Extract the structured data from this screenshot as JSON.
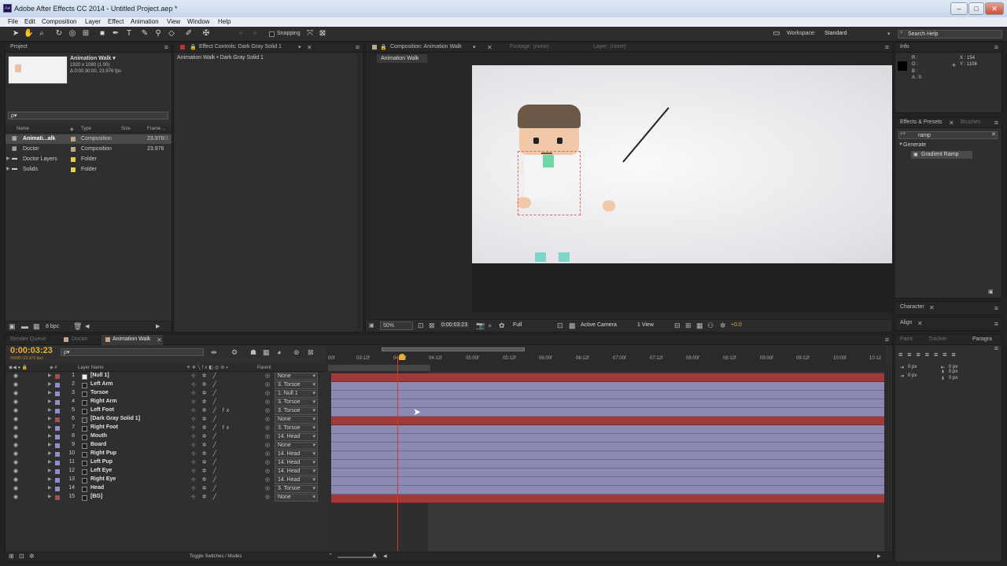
{
  "window": {
    "title": "Adobe After Effects CC 2014 - Untitled Project.aep *",
    "app_icon": "Ae",
    "min": "–",
    "max": "□",
    "close": "✕"
  },
  "menu": [
    "File",
    "Edit",
    "Composition",
    "Layer",
    "Effect",
    "Animation",
    "View",
    "Window",
    "Help"
  ],
  "toolbar": {
    "snapping": "Snapping",
    "workspace_label": "Workspace:",
    "workspace_value": "Standard",
    "search_placeholder": "Search Help"
  },
  "project": {
    "tab": "Project",
    "comp_name": "Animation Walk ▾",
    "comp_size": "1920 x 1080 (1.00)",
    "comp_dur": "Δ 0:00:30:00, 23.976 fps",
    "search_placeholder": "ρ▾",
    "columns": [
      "Name",
      "Type",
      "Size",
      "Frame ..."
    ],
    "items": [
      {
        "name": "Animati...alk",
        "type": "Composition",
        "frame": "23.976",
        "color": "#b9a88a",
        "icon": "comp"
      },
      {
        "name": "Doctor",
        "type": "Composition",
        "frame": "23.976",
        "color": "#b9a88a",
        "icon": "comp"
      },
      {
        "name": "Doctor Layers",
        "type": "Folder",
        "frame": "",
        "color": "#e6d04a",
        "icon": "folder"
      },
      {
        "name": "Solids",
        "type": "Folder",
        "frame": "",
        "color": "#e6d04a",
        "icon": "folder"
      }
    ],
    "bpc": "8 bpc"
  },
  "effect_controls": {
    "tab": "Effect Controls: Dark Gray Solid 1",
    "subtitle": "Animation Walk • Dark Gray Solid 1"
  },
  "viewer": {
    "tab": "Composition: Animation Walk",
    "tab_footage": "Footage: (none)",
    "tab_layer": "Layer: (none)",
    "subtab": "Animation Walk",
    "zoom": "50%",
    "timecode": "0:00:03:23",
    "resolution": "Full",
    "camera": "Active Camera",
    "views": "1 View",
    "exposure": "+0.0"
  },
  "info": {
    "tab": "Info",
    "r": "R :",
    "g": "G :",
    "b": "B :",
    "a": "A : 0",
    "x": "X : 154",
    "y": "Y : 1108"
  },
  "effects": {
    "tab": "Effects & Presets",
    "tab2": "Brushes",
    "search": "ramp",
    "category": "Generate",
    "item": "Gradient Ramp"
  },
  "character": {
    "tab": "Character"
  },
  "align": {
    "tab": "Align"
  },
  "paragraph": {
    "tabs": [
      "Paint",
      "Tracker",
      "Paragra"
    ],
    "v1": "0 px",
    "v2": "0 px",
    "v3": "0 px",
    "v4": "0 px",
    "v5": "0 px"
  },
  "timeline": {
    "tab_rq": "Render Queue",
    "tab_doc": "Doctor",
    "tab_aw": "Animation Walk",
    "timecode": "0:00:03:23",
    "frames": "00095 (23.976 fps)",
    "search_placeholder": "ρ▾",
    "col_layer": "Layer Name",
    "col_parent": "Parent",
    "toggle": "Toggle Switches / Modes",
    "ruler": [
      "00f",
      "03:12f",
      "04:00f",
      "04:12f",
      "05:00f",
      "05:12f",
      "06:00f",
      "06:12f",
      "07:00f",
      "07:12f",
      "08:00f",
      "08:12f",
      "09:00f",
      "09:12f",
      "10:00f",
      "10:12"
    ],
    "layers": [
      {
        "num": "1",
        "name": "[Null 1]",
        "parent": "None",
        "color": "#a05050",
        "red": true
      },
      {
        "num": "2",
        "name": "Left Arm",
        "parent": "3. Torsoe",
        "color": "#9090c8",
        "red": false
      },
      {
        "num": "3",
        "name": "Torsoe",
        "parent": "1. Null 1",
        "color": "#9090c8",
        "red": false
      },
      {
        "num": "4",
        "name": "Right Arm",
        "parent": "3. Torsoe",
        "color": "#9090c8",
        "red": false
      },
      {
        "num": "5",
        "name": "Left Foot",
        "parent": "3. Torsoe",
        "color": "#9090c8",
        "red": false,
        "fx": true
      },
      {
        "num": "6",
        "name": "[Dark Gray Solid 1]",
        "parent": "None",
        "color": "#a05050",
        "red": true
      },
      {
        "num": "7",
        "name": "Right Foot",
        "parent": "3. Torsoe",
        "color": "#9090c8",
        "red": false,
        "fx": true
      },
      {
        "num": "8",
        "name": "Mouth",
        "parent": "14. Head",
        "color": "#9090c8",
        "red": false
      },
      {
        "num": "9",
        "name": "Board",
        "parent": "None",
        "color": "#9090c8",
        "red": false
      },
      {
        "num": "10",
        "name": "Right Pup",
        "parent": "14. Head",
        "color": "#9090c8",
        "red": false
      },
      {
        "num": "11",
        "name": "Left Pup",
        "parent": "14. Head",
        "color": "#9090c8",
        "red": false
      },
      {
        "num": "12",
        "name": "Left Eye",
        "parent": "14. Head",
        "color": "#9090c8",
        "red": false
      },
      {
        "num": "13",
        "name": "Right Eye",
        "parent": "14. Head",
        "color": "#9090c8",
        "red": false
      },
      {
        "num": "14",
        "name": "Head",
        "parent": "3. Torsoe",
        "color": "#9090c8",
        "red": false
      },
      {
        "num": "15",
        "name": "[BG]",
        "parent": "None",
        "color": "#a05050",
        "red": true
      }
    ]
  }
}
